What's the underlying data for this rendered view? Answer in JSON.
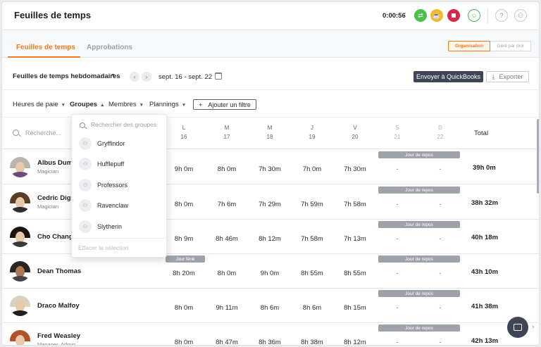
{
  "header": {
    "title": "Feuilles de temps",
    "timer": "0:00:56"
  },
  "tabs": {
    "active": "Feuilles de temps",
    "inactive": "Approbations",
    "seg_org": "Organisation",
    "seg_manager": "Géré par moi"
  },
  "toolbar": {
    "week_title": "Feuilles de temps hebdomadaires",
    "date_range": "sept. 16 - sept. 22",
    "quickbooks": "Envoyer à QuickBooks",
    "export": "Exporter"
  },
  "filters": {
    "paie": "Heures de paie",
    "groupes": "Groupes",
    "membres": "Membres",
    "plannings": "Plannings",
    "add": "Ajouter un filtre"
  },
  "table": {
    "search_placeholder": "Recherche...",
    "total_label": "Total",
    "days": [
      {
        "letter": "L",
        "num": "16"
      },
      {
        "letter": "M",
        "num": "17"
      },
      {
        "letter": "M",
        "num": "18"
      },
      {
        "letter": "J",
        "num": "19"
      },
      {
        "letter": "V",
        "num": "20"
      },
      {
        "letter": "S",
        "num": "21"
      },
      {
        "letter": "D",
        "num": "22"
      }
    ],
    "rows": [
      {
        "name": "Albus Dumbl",
        "role": "Magician",
        "cells": [
          "9h 0m",
          "8h 0m",
          "7h 30m",
          "7h 0m",
          "7h 30m",
          "-",
          "-"
        ],
        "total": "39h 0m",
        "badge": "Jour de repos"
      },
      {
        "name": "Cedric Diggo",
        "role": "Magician",
        "cells": [
          "8h 0m",
          "7h 6m",
          "7h 29m",
          "7h 59m",
          "7h 58m",
          "-",
          "-"
        ],
        "total": "38h 32m",
        "badge": "Jour de repos"
      },
      {
        "name": "Cho Chang",
        "role": "",
        "cells": [
          "8h 9m",
          "8h 46m",
          "8h 12m",
          "7h 58m",
          "7h 13m",
          "-",
          "-"
        ],
        "total": "40h 18m",
        "badge": "Jour de repos"
      },
      {
        "name": "Dean Thomas",
        "role": "",
        "cells": [
          "8h 20m",
          "8h 0m",
          "9h 0m",
          "8h 55m",
          "8h 55m",
          "-",
          "-"
        ],
        "total": "43h 10m",
        "badge": "Jour de repos",
        "holiday": "Jour férié"
      },
      {
        "name": "Draco Malfoy",
        "role": "",
        "cells": [
          "8h 0m",
          "9h 11m",
          "8h 6m",
          "8h 6m",
          "8h 15m",
          "-",
          "-"
        ],
        "total": "41h 38m",
        "badge": "Jour de repos"
      },
      {
        "name": "Fred Weasley",
        "role": "Manager, Admin",
        "cells": [
          "8h 0m",
          "8h 47m",
          "8h 36m",
          "8h 38m",
          "8h 12m",
          "-",
          "-"
        ],
        "total": "42h 13m",
        "badge": "Jour de repos"
      }
    ]
  },
  "dropdown": {
    "search_placeholder": "Rechercher des groupes",
    "items": [
      "Gryffindor",
      "Hufflepuff",
      "Professors",
      "Ravenclaw",
      "Slytherin"
    ],
    "clear": "Effacer la sélection"
  },
  "colors": {
    "accent": "#f07b1d",
    "dark_button": "#3e4556",
    "badge_grey": "#9ea3ab"
  }
}
